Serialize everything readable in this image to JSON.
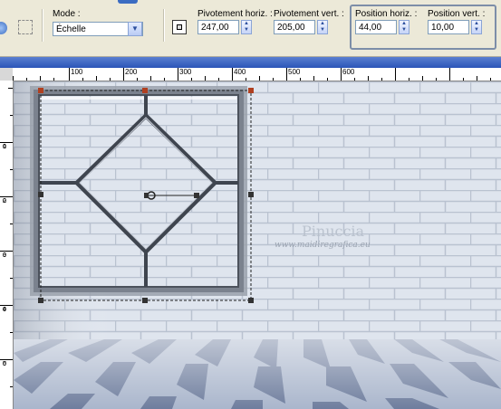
{
  "toolbar": {
    "mode_label": "Mode :",
    "mode_value": "Échelle",
    "pivot_h_label": "Pivotement horiz. :",
    "pivot_h_value": "247,00",
    "pivot_v_label": "Pivotement vert. :",
    "pivot_v_value": "205,00",
    "pos_h_label": "Position horiz. :",
    "pos_h_value": "44,00",
    "pos_v_label": "Position vert. :",
    "pos_v_value": "10,00"
  },
  "ruler_h": [
    "100",
    "200",
    "300",
    "400",
    "500",
    "600"
  ],
  "ruler_v": [
    [
      "1",
      "0",
      "0"
    ],
    [
      "2",
      "0",
      "0"
    ],
    [
      "3",
      "0",
      "0"
    ],
    [
      "4",
      "0",
      "0"
    ],
    [
      "5",
      "0",
      "0"
    ]
  ],
  "canvas": {
    "watermark_name": "Pinuccia",
    "watermark_url": "www.maidiregrafica.eu"
  },
  "colors": {
    "wall": "#dfe5ee",
    "brick_line": "#b9c2d0",
    "floor_dark": "#7d8aa8",
    "floor_light": "#f2f4f8",
    "frame": "#8a919c",
    "highlight_box": "#7d8ea8"
  }
}
